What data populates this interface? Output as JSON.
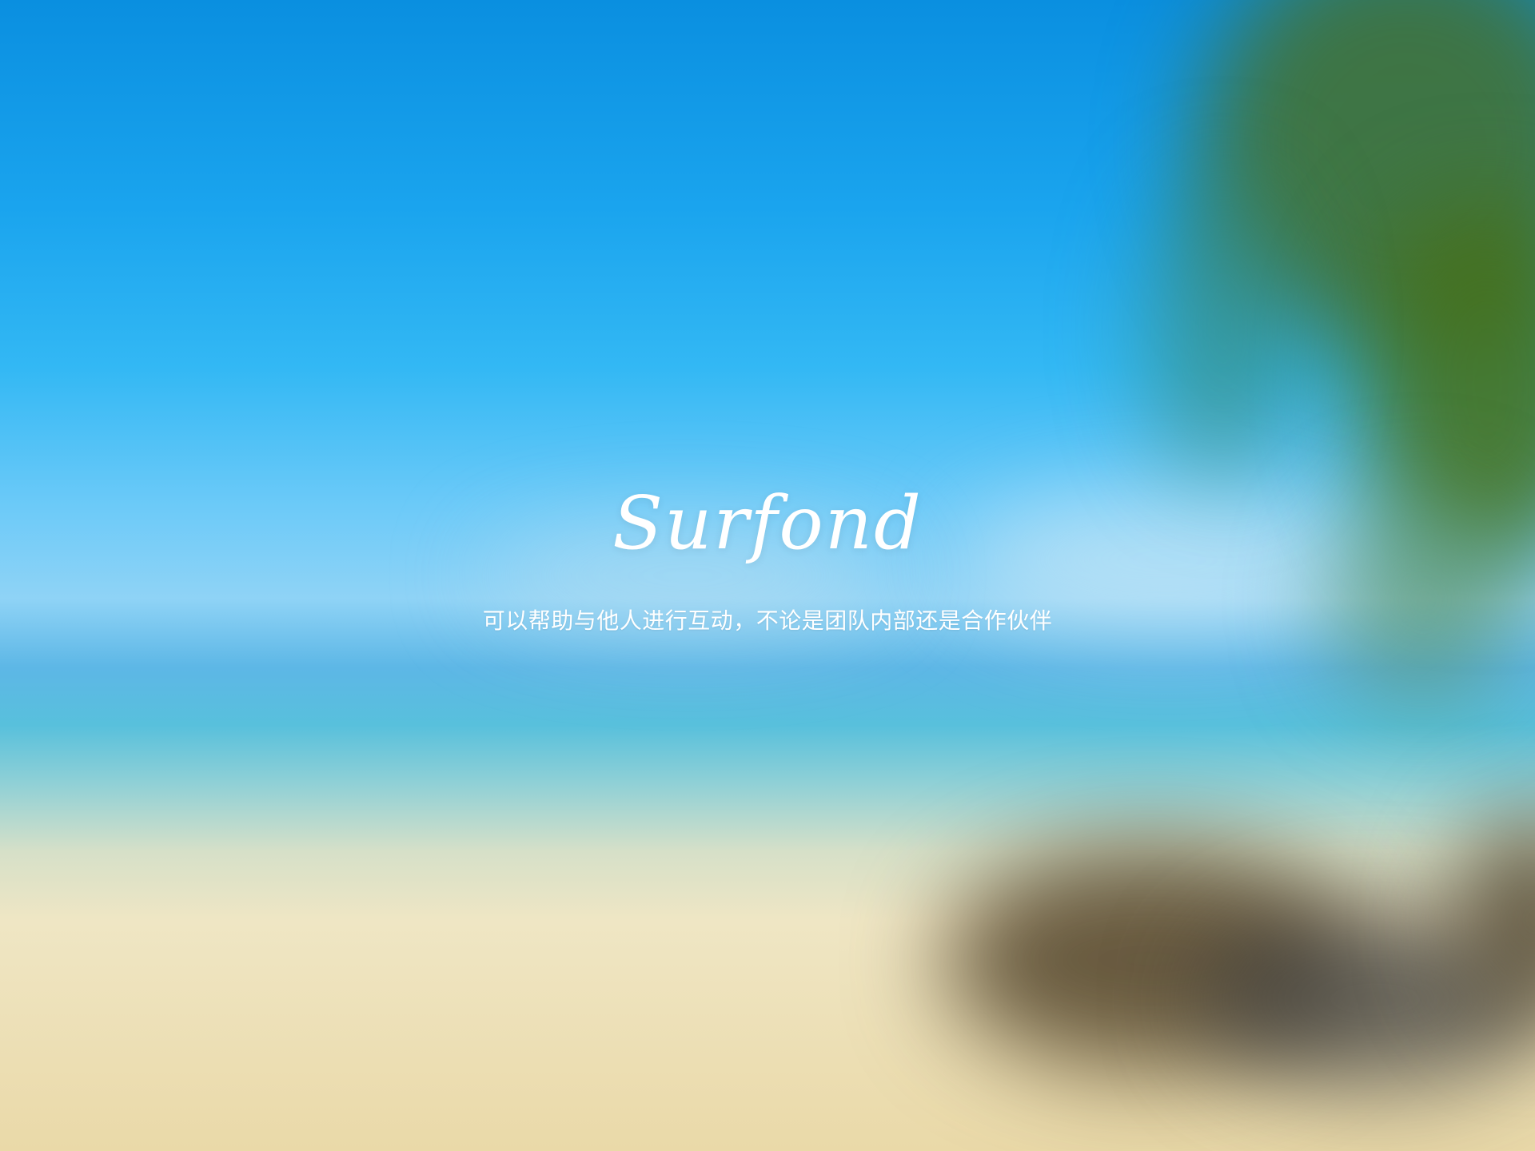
{
  "brand": {
    "name": "Surfond",
    "tagline": "可以帮助与他人进行互动，不论是团队内部还是合作伙伴"
  },
  "colors": {
    "sky_top": "#0a8fe0",
    "sky_mid": "#33b8f4",
    "horizon": "#8fd3f6",
    "sea": "#58c0dc",
    "sand": "#ead9a8",
    "text": "#ffffff"
  }
}
